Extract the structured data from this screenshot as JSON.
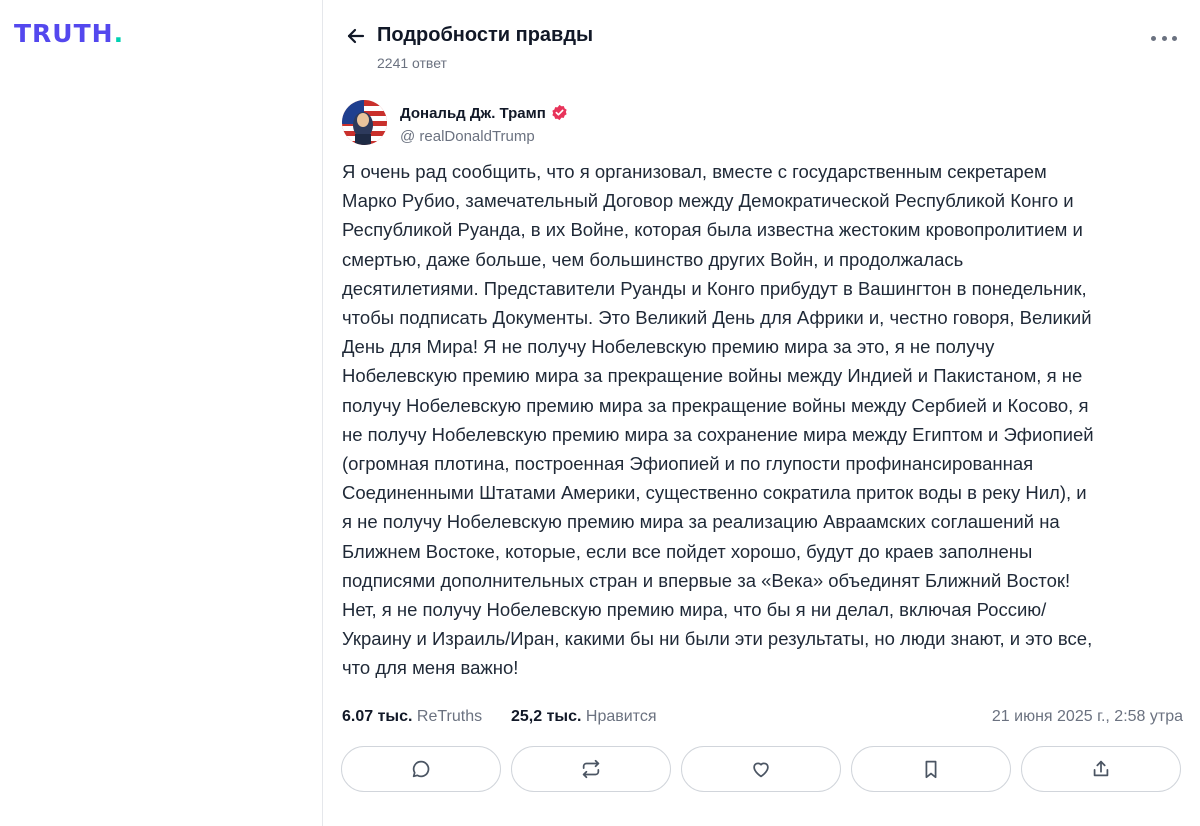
{
  "brand": {
    "logo_text": "TRUTH",
    "logo_dot": ".",
    "accent": "#5448ee",
    "dot_color": "#00d1b2"
  },
  "header": {
    "title": "Подробности правды",
    "subtitle": "2241 ответ",
    "back_icon": "arrow-left-icon",
    "more_icon": "more-horizontal-icon"
  },
  "post": {
    "author_name": "Дональд Дж. Трамп",
    "handle": "@ realDonaldTrump",
    "verified_color": "#e8335a",
    "text": "Я очень рад сообщить, что я организовал, вместе с государственным секретарем\nМарко Рубио, замечательный Договор между Демократической Республикой Конго и\nРеспубликой Руанда, в их Войне, которая была известна жестоким кровопролитием и\nсмертью, даже больше, чем большинство других Войн, и продолжалась\nдесятилетиями. Представители Руанды и Конго прибудут в Вашингтон в понедельник,\nчтобы подписать Документы. Это Великий День для Африки и, честно говоря, Великий\nДень для Мира! Я не получу Нобелевскую премию мира за это, я не получу\nНобелевскую премию мира за прекращение войны между Индией и Пакистаном, я не\nполучу Нобелевскую премию мира за прекращение войны между Сербией и Косово, я\nне получу Нобелевскую премию мира за сохранение мира между Египтом и Эфиопией\n(огромная плотина, построенная Эфиопией и по глупости профинансированная\nСоединенными Штатами Америки, существенно сократила приток воды в реку Нил), и\nя не получу Нобелевскую премию мира за реализацию Авраамских соглашений на\nБлижнем Востоке, которые, если все пойдет хорошо, будут до краев заполнены\nподписями дополнительных стран и впервые за «Века» объединят Ближний Восток!\nНет, я не получу Нобелевскую премию мира, что бы я ни делал, включая Россию/\nУкраину и Израиль/Иран, какими бы ни были эти результаты, но люди знают, и это все,\nчто для меня важно!"
  },
  "stats": {
    "retruths_count": "6.07 тыс.",
    "retruths_label": "ReTruths",
    "likes_count": "25,2 тыс.",
    "likes_label": "Нравится",
    "timestamp": "21 июня 2025 г., 2:58 утра"
  },
  "actions": [
    {
      "name": "reply-button",
      "icon": "comment-icon"
    },
    {
      "name": "retruth-button",
      "icon": "repost-icon"
    },
    {
      "name": "like-button",
      "icon": "heart-icon"
    },
    {
      "name": "bookmark-button",
      "icon": "bookmark-icon"
    },
    {
      "name": "share-button",
      "icon": "share-icon"
    }
  ]
}
